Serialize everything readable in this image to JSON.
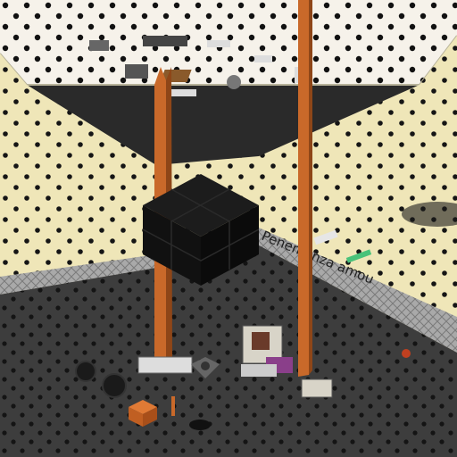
{
  "scene": {
    "type": "isometric-voxel-room",
    "colors": {
      "ceiling": "#f6f2ea",
      "ceiling_dot": "#111111",
      "wall": "#efe6b8",
      "wall_stripe": "#cfc7a6",
      "floor": "#3d3d3d",
      "floor_dot": "#151515",
      "pillar": "#c9692a",
      "pillar_dark": "#8e4618",
      "cube": "#141414",
      "baseboard": "#9a9a9a"
    }
  },
  "sign": {
    "text": "Penemanza amou"
  },
  "icons": [
    "cube-block",
    "orange-pillar",
    "spool",
    "wooden-table",
    "orange-box",
    "machine-rig"
  ]
}
